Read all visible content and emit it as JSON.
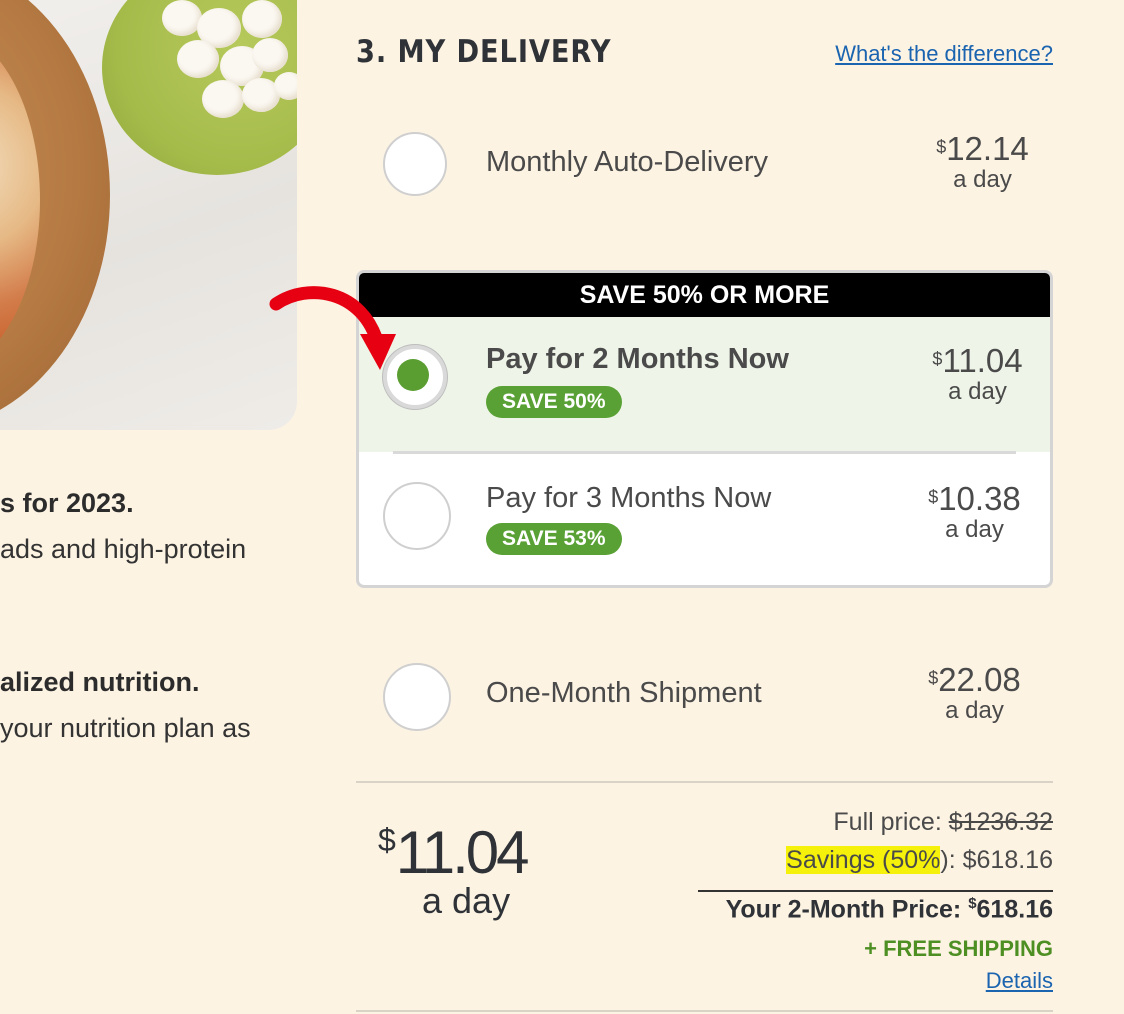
{
  "left_copy": {
    "heading_1": "s for 2023.",
    "body_1": "ads and high-protein",
    "heading_2": "alized nutrition.",
    "body_2": "your nutrition plan as"
  },
  "section": {
    "title": "3. MY DELIVERY",
    "help_link": "What's the difference?"
  },
  "options": [
    {
      "label": "Monthly Auto-Delivery",
      "currency": "$",
      "price": "12.14",
      "per": "a day",
      "selected": false
    },
    {
      "label": "Pay for 2 Months Now",
      "currency": "$",
      "price": "11.04",
      "per": "a day",
      "badge": "SAVE 50%",
      "selected": true
    },
    {
      "label": "Pay for 3 Months Now",
      "currency": "$",
      "price": "10.38",
      "per": "a day",
      "badge": "SAVE 53%",
      "selected": false
    },
    {
      "label": "One-Month Shipment",
      "currency": "$",
      "price": "22.08",
      "per": "a day",
      "selected": false
    }
  ],
  "promo_banner": "SAVE 50% OR MORE",
  "summary": {
    "currency": "$",
    "daily_price": "11.04",
    "per": "a day",
    "full_price_label": "Full price: ",
    "full_price_value": "$1236.32",
    "savings_label": "Savings (50%",
    "savings_suffix": "): $618.16",
    "total_label": "Your 2-Month Price: ",
    "total_currency": "$",
    "total_value": "618.16",
    "shipping": "+ FREE SHIPPING",
    "details_link": "Details"
  },
  "colors": {
    "page_bg": "#fdf3e3",
    "accent_green": "#5aa135",
    "link_blue": "#1a64b0",
    "arrow_red": "#e60012",
    "highlight": "#f5f10a"
  }
}
